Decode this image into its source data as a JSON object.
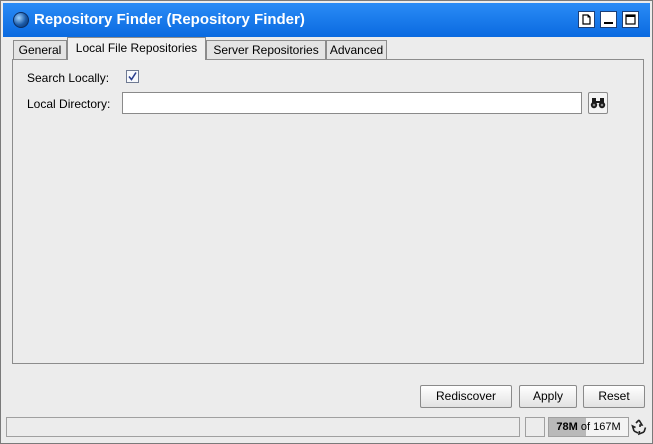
{
  "window": {
    "title": "Repository Finder (Repository Finder)",
    "buttons": [
      "restore-icon",
      "minimize-icon",
      "maximize-icon"
    ]
  },
  "tabs": [
    {
      "label": "General",
      "active": false
    },
    {
      "label": "Local File Repositories",
      "active": true
    },
    {
      "label": "Server Repositories",
      "active": false
    },
    {
      "label": "Advanced",
      "active": false
    }
  ],
  "form": {
    "search_locally_label": "Search Locally:",
    "search_locally_checked": true,
    "local_directory_label": "Local Directory:",
    "local_directory_value": "",
    "browse_icon": "binoculars-icon"
  },
  "actions": {
    "rediscover_label": "Rediscover",
    "apply_label": "Apply",
    "reset_label": "Reset"
  },
  "status": {
    "memory_used": "78M",
    "memory_of": "of",
    "memory_total": "167M",
    "memory_fraction": 0.467,
    "gc_icon": "recycle-icon"
  },
  "colors": {
    "titlebar": "#1477ea",
    "title_text": "#ffffff",
    "background": "#ececec"
  }
}
